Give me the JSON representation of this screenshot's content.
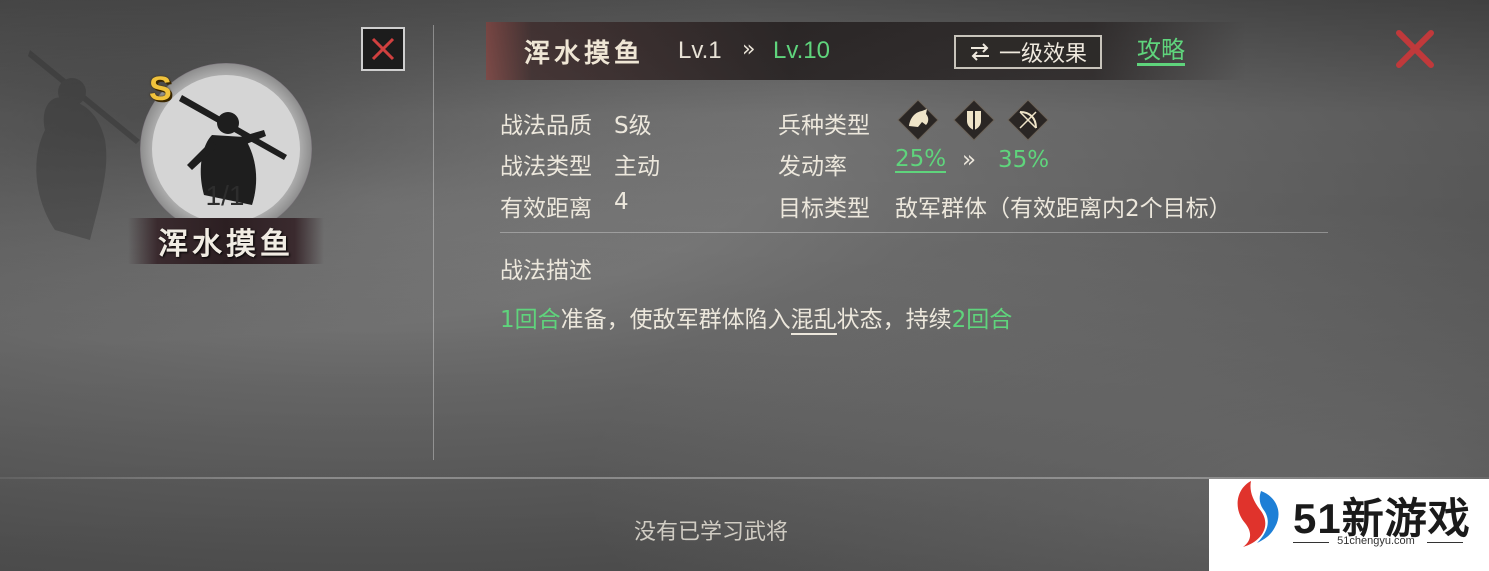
{
  "skill_card": {
    "grade": "S",
    "count": "1/1",
    "name": "浑水摸鱼"
  },
  "header": {
    "title": "浑水摸鱼",
    "level_from": "Lv.1",
    "level_arrow": "»",
    "level_to": "Lv.10",
    "effect_button_label": "一级效果",
    "guide_label": "攻略"
  },
  "info": {
    "quality_label": "战法品质",
    "quality_value": "S级",
    "type_label": "战法类型",
    "type_value": "主动",
    "range_label": "有效距离",
    "range_value": "4",
    "troop_label": "兵种类型",
    "troop_icons": [
      "cavalry-icon",
      "shield-icon",
      "bow-icon"
    ],
    "rate_label": "发动率",
    "rate_from": "25%",
    "rate_arrow": "»",
    "rate_to": "35%",
    "target_label": "目标类型",
    "target_value": "敌军群体（有效距离内2个目标）"
  },
  "description": {
    "title": "战法描述",
    "part1": "1回合",
    "part2": "准备，使敌军群体陷入",
    "part3": "混乱",
    "part4": "状态，持续",
    "part5": "2回合"
  },
  "footer": {
    "empty_text": "没有已学习武将"
  },
  "watermark": {
    "brand": "51新游戏",
    "url": "51chengyu.com"
  },
  "colors": {
    "accent_green": "#5fd47c",
    "grade_gold": "#f0c23c",
    "close_red": "#c0393b",
    "ring_purple": "#c777c7"
  }
}
